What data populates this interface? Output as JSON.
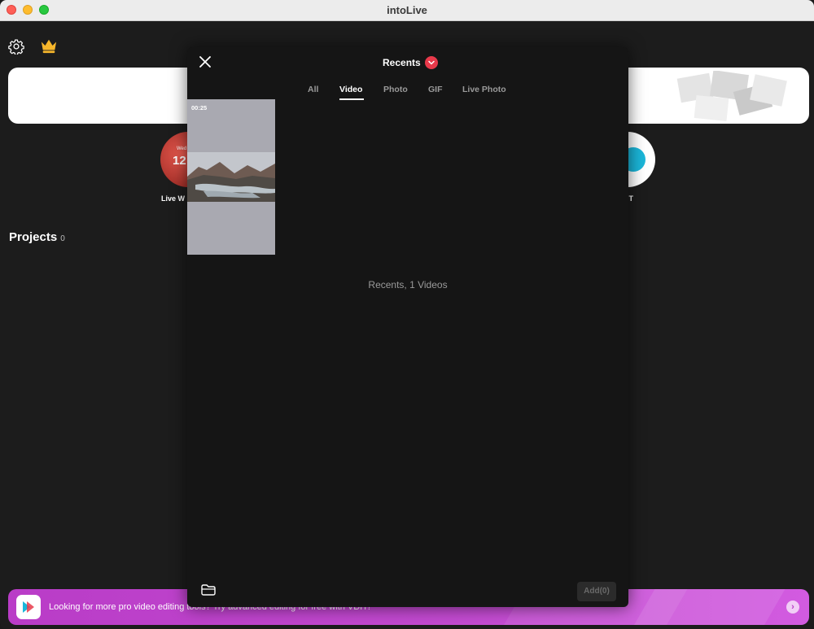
{
  "window": {
    "title": "intoLive"
  },
  "home": {
    "features": [
      {
        "label": "Live W",
        "date": "Wed",
        "number": "12"
      },
      {
        "label": "IT"
      }
    ],
    "projects": {
      "label": "Projects",
      "count": "0"
    },
    "promo": {
      "text": "Looking for more pro video editing tools? Try advanced editing for free with VDIT!"
    }
  },
  "picker": {
    "title": "Recents",
    "tabs": [
      {
        "label": "All",
        "active": false
      },
      {
        "label": "Video",
        "active": true
      },
      {
        "label": "Photo",
        "active": false
      },
      {
        "label": "GIF",
        "active": false
      },
      {
        "label": "Live Photo",
        "active": false
      }
    ],
    "items": [
      {
        "duration": "00:25"
      }
    ],
    "summary": "Recents, 1 Videos",
    "add_label": "Add(0)"
  },
  "icons": {
    "settings": "gear-icon",
    "premium": "crown-icon",
    "close": "close-icon",
    "dropdown": "chevron-down-icon",
    "folder": "folder-icon",
    "arrow": "chevron-right-icon"
  },
  "colors": {
    "accent": "#e8394a",
    "promo": "#b93cc7",
    "modal_bg": "#151515",
    "app_bg": "#1c1c1c"
  }
}
